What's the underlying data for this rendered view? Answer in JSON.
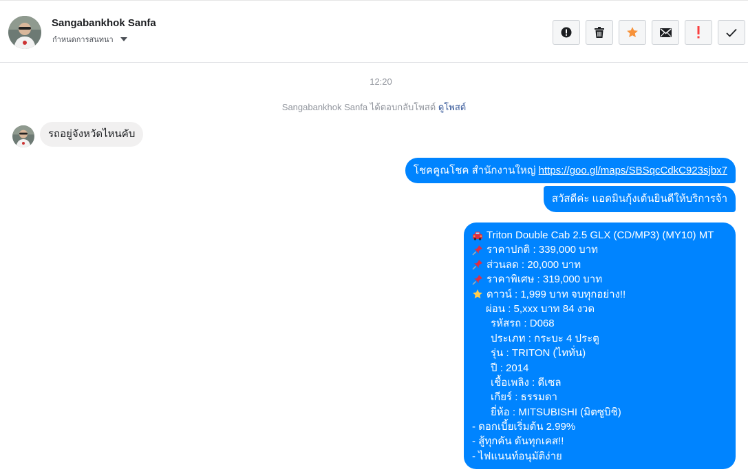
{
  "header": {
    "contact_name": "Sangabankhok Sanfa",
    "assign_label": "กำหนดการสนทนา",
    "toolbar": [
      {
        "name": "report-spam-button",
        "icon": "alert-circle-icon"
      },
      {
        "name": "delete-button",
        "icon": "trash-icon"
      },
      {
        "name": "star-button",
        "icon": "star-icon",
        "color": "#f7923a"
      },
      {
        "name": "mark-unread-button",
        "icon": "envelope-icon"
      },
      {
        "name": "follow-up-button",
        "icon": "exclamation-icon",
        "color": "#fa3e3e"
      },
      {
        "name": "mark-done-button",
        "icon": "check-icon"
      }
    ]
  },
  "thread": {
    "timestamp": "12:20",
    "system_message": "Sangabankhok Sanfa ได้ตอบกลับโพสต์",
    "system_link": "ดูโพสต์",
    "incoming_message": "รถอยู่จังหวัดไหนคับ",
    "outgoing": {
      "msg1_text": "โชคคูณโชค สำนักงานใหญ่ ",
      "msg1_link": "https://goo.gl/maps/SBSqcCdkC923sjbx7",
      "msg2_text": "สวัสดีค่ะ แอดมินกุ้งเต้นยินดีให้บริการจ้า",
      "msg3_lines": [
        {
          "icon": "car-icon",
          "text": "Triton Double Cab 2.5 GLX (CD/MP3) (MY10) MT"
        },
        {
          "icon": "pushpin-icon",
          "text": "ราคาปกติ : 339,000 บาท"
        },
        {
          "icon": "pushpin-icon",
          "text": "ส่วนลด : 20,000 บาท"
        },
        {
          "icon": "pushpin-icon",
          "text": "ราคาพิเศษ : 319,000 บาท"
        },
        {
          "icon": "star-icon",
          "text": "ดาวน์ : 1,999 บาท จบทุกอย่าง!!"
        },
        {
          "indent": 1,
          "text": "ผ่อน : 5,xxx บาท 84 งวด"
        },
        {
          "indent": 2,
          "text": "รหัสรถ : D068"
        },
        {
          "indent": 2,
          "text": "ประเภท : กระบะ 4 ประตู"
        },
        {
          "indent": 2,
          "text": "รุ่น : TRITON (ไททั่น)"
        },
        {
          "indent": 2,
          "text": "ปี : 2014"
        },
        {
          "indent": 2,
          "text": "เชื้อเพลิง : ดีเซล"
        },
        {
          "indent": 2,
          "text": "เกียร์ : ธรรมดา"
        },
        {
          "indent": 2,
          "text": "ยี่ห้อ : MITSUBISHI (มิตซูบิชิ)"
        },
        {
          "text": "- ดอกเบี้ยเริ่มต้น 2.99%"
        },
        {
          "text": "- สู้ทุกคัน ดันทุกเคส!!"
        },
        {
          "text": "- ไฟแนนท์อนุมัติง่าย"
        }
      ]
    }
  },
  "colors": {
    "outgoing_bubble": "#0084ff",
    "incoming_bubble": "#f1f0f0",
    "link": "#365899"
  }
}
